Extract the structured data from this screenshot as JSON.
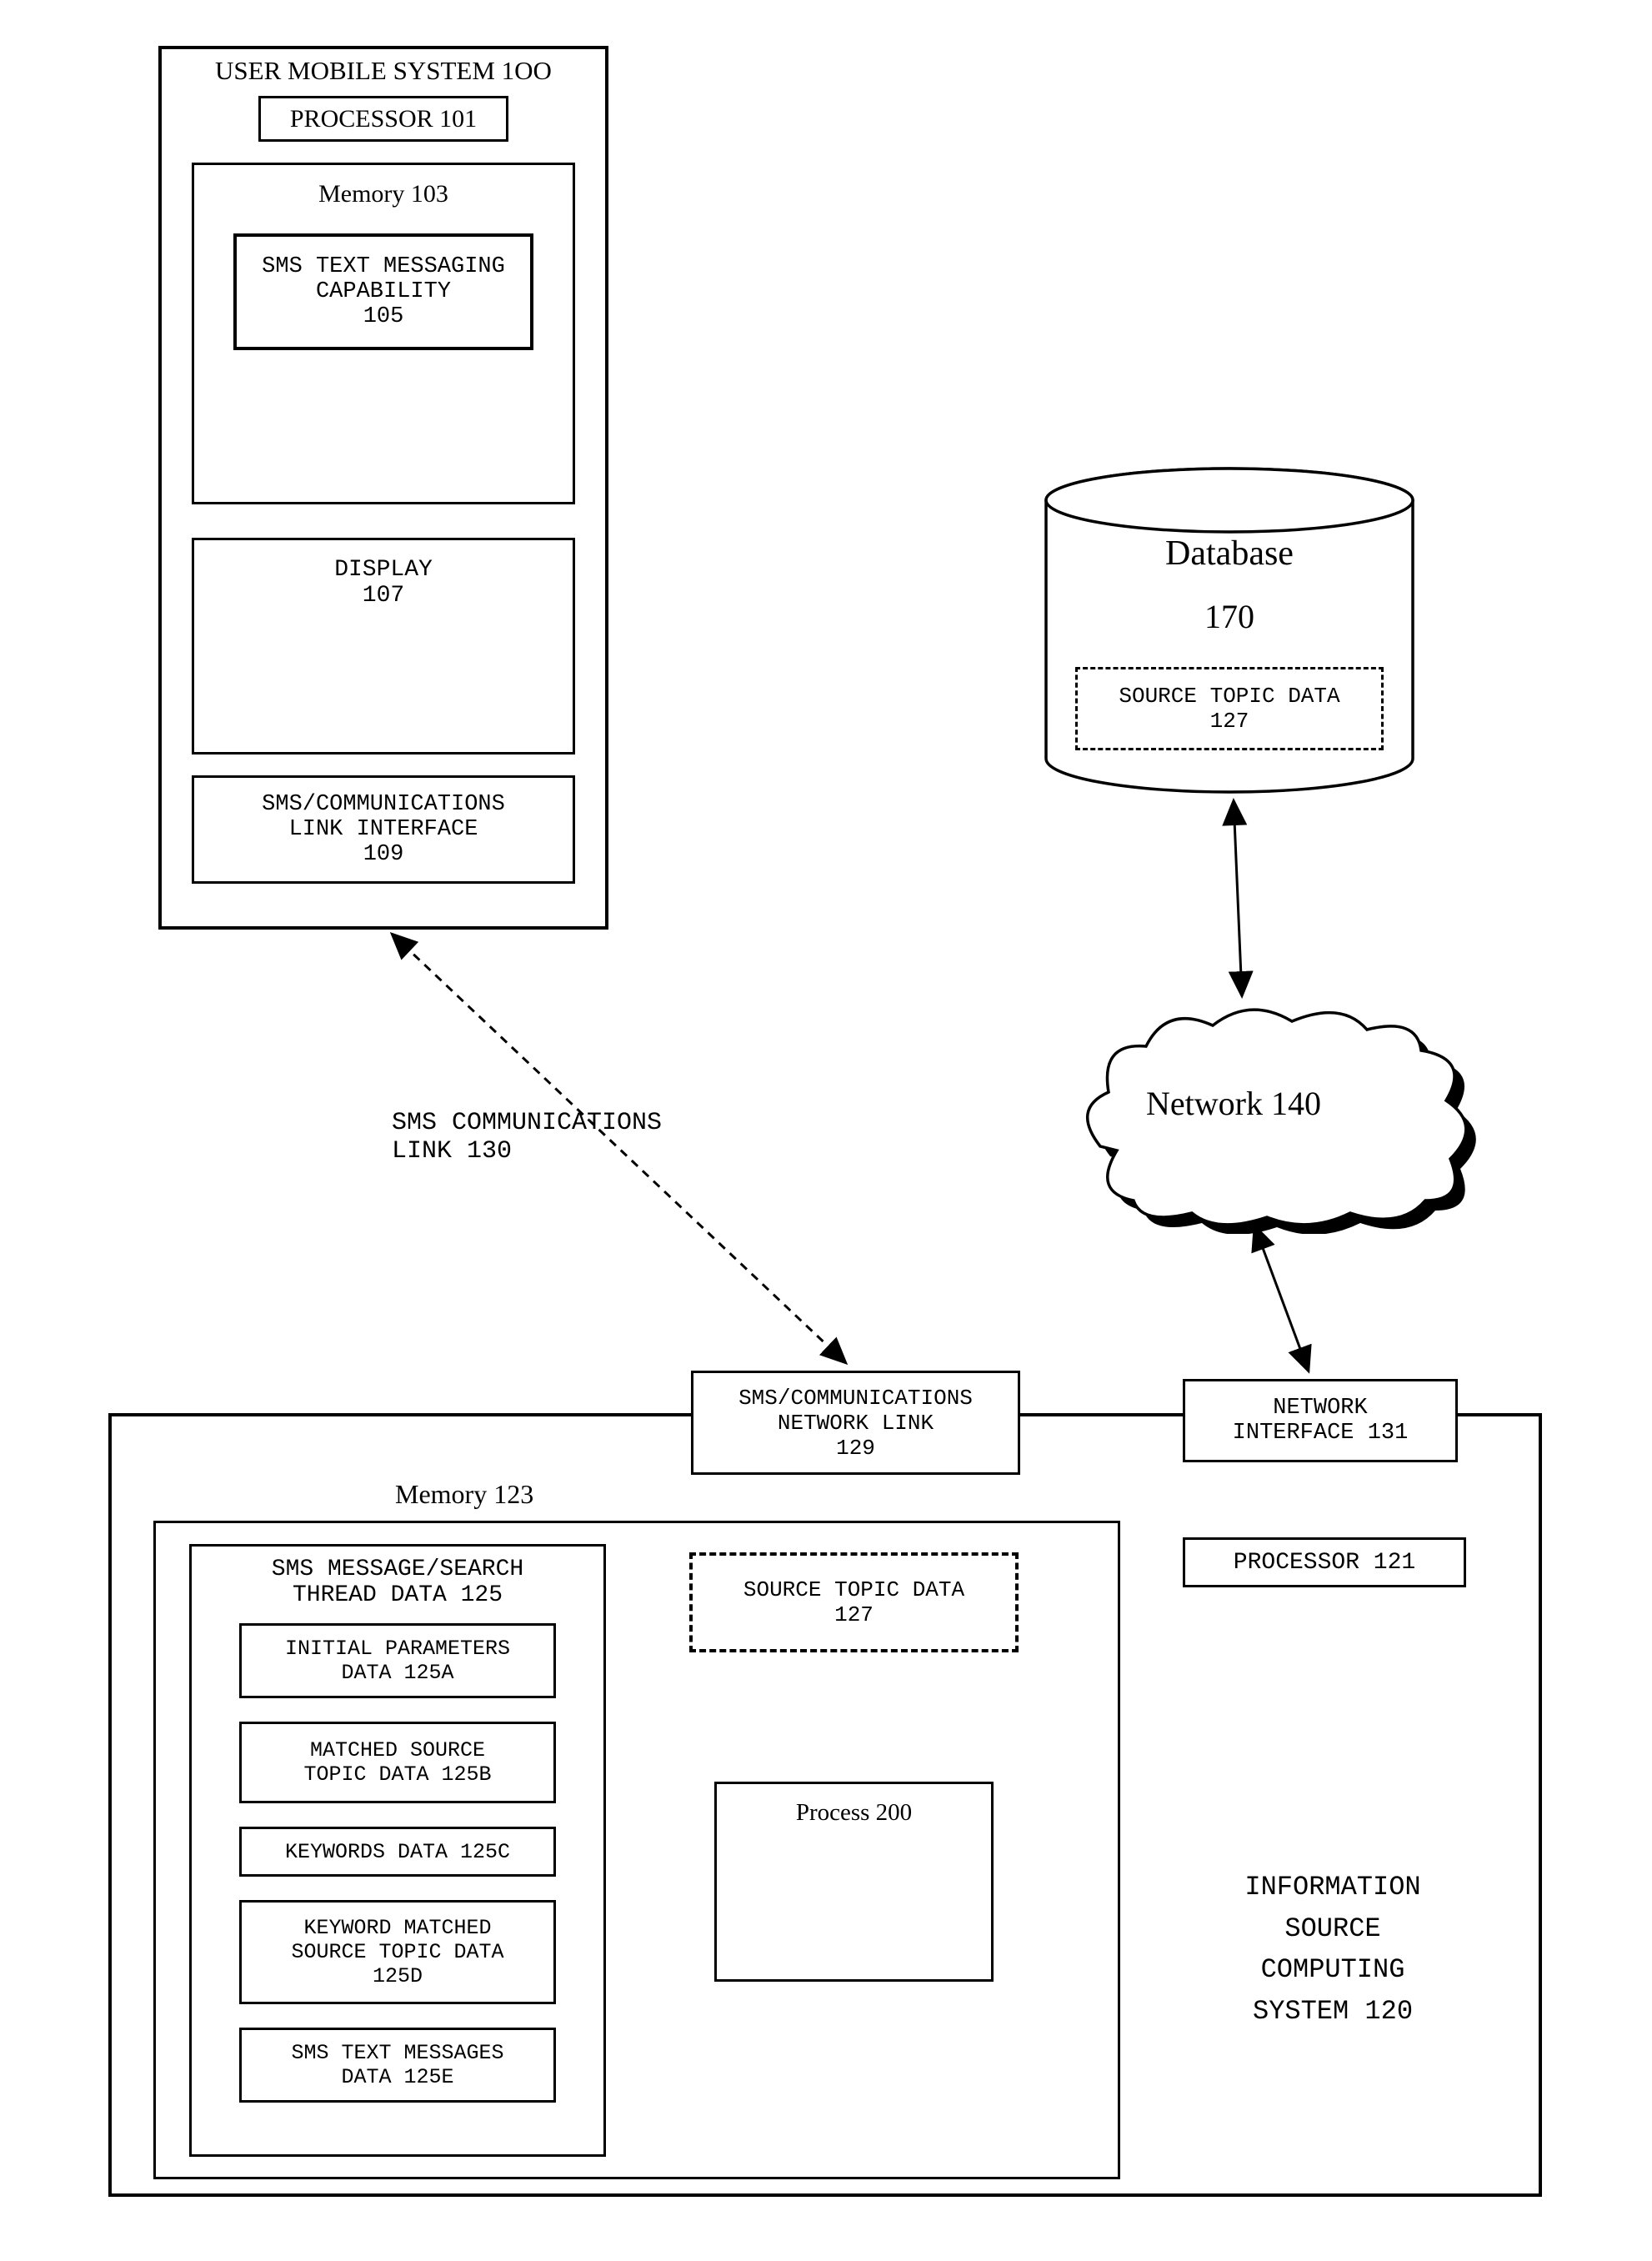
{
  "mobileSystem": {
    "title": "USER MOBILE SYSTEM 1OO",
    "processor": "PROCESSOR 101",
    "memoryLabel": "Memory 103",
    "smsCapLine1": "SMS TEXT MESSAGING",
    "smsCapLine2": "CAPABILITY",
    "smsCapLine3": "105",
    "displayLine1": "DISPLAY",
    "displayLine2": "107",
    "linkLine1": "SMS/COMMUNICATIONS",
    "linkLine2": "LINK INTERFACE",
    "linkLine3": "109"
  },
  "database": {
    "title": "Database",
    "num": "170",
    "sourceTopicLine1": "SOURCE TOPIC DATA",
    "sourceTopicLine2": "127"
  },
  "network": {
    "label": "Network 140"
  },
  "smsLink": {
    "line1": "SMS COMMUNICATIONS",
    "line2": "LINK 130"
  },
  "infoSystem": {
    "memoryLabel": "Memory  123",
    "smsNetLine1": "SMS/COMMUNICATIONS",
    "smsNetLine2": "NETWORK LINK",
    "smsNetLine3": "129",
    "netIfLine1": "NETWORK",
    "netIfLine2": "INTERFACE 131",
    "processorLabel": "PROCESSOR  121",
    "threadLine1": "SMS MESSAGE/SEARCH",
    "threadLine2": "THREAD DATA 125",
    "initParamsLine1": "INITIAL PARAMETERS",
    "initParamsLine2": "DATA 125A",
    "matchedLine1": "MATCHED SOURCE",
    "matchedLine2": "TOPIC DATA 125B",
    "keywordsData": "KEYWORDS DATA 125C",
    "keywordMatchedLine1": "KEYWORD MATCHED",
    "keywordMatchedLine2": "SOURCE TOPIC DATA",
    "keywordMatchedLine3": "125D",
    "smsTextLine1": "SMS TEXT MESSAGES",
    "smsTextLine2": "DATA 125E",
    "sourceTopicLine1": "SOURCE TOPIC DATA",
    "sourceTopicLine2": "127",
    "processLabel": "Process 200",
    "sysLine1": "INFORMATION",
    "sysLine2": "SOURCE",
    "sysLine3": "COMPUTING",
    "sysLine4": "SYSTEM 120"
  }
}
